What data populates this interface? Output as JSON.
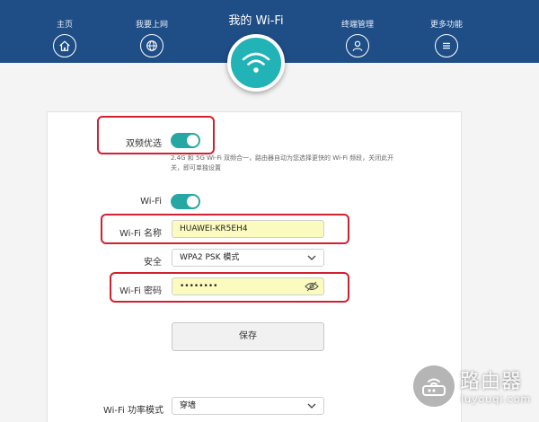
{
  "header": {
    "title": "我的 Wi-Fi",
    "nav": [
      {
        "label": "主页",
        "icon": "home-icon"
      },
      {
        "label": "我要上网",
        "icon": "globe-icon"
      },
      {
        "label": "终端管理",
        "icon": "user-icon"
      },
      {
        "label": "更多功能",
        "icon": "menu-icon"
      }
    ],
    "center_icon": "wifi-icon"
  },
  "form": {
    "dual_band": {
      "label": "双频优选",
      "on": true,
      "description": "2.4G 和 5G Wi-Fi 双频合一，路由器自动为您选择更快的 Wi-Fi 频段，关闭此开关，即可单独设置"
    },
    "wifi": {
      "label": "Wi-Fi",
      "on": true
    },
    "wifi_name": {
      "label": "Wi-Fi 名称",
      "value": "HUAWEI-KR5EH4"
    },
    "security": {
      "label": "安全",
      "value": "WPA2 PSK 模式"
    },
    "wifi_password": {
      "label": "Wi-Fi 密码",
      "value": "••••••••"
    },
    "save_label": "保存",
    "power_mode": {
      "label": "Wi-Fi 功率模式",
      "value": "穿墙"
    }
  },
  "watermark": {
    "name": "路由器",
    "site": "luyouqi.com"
  },
  "colors": {
    "header_bg": "#1f4e86",
    "accent": "#27a7a4",
    "highlight": "#d2202f",
    "field_fill": "#fbfbbf"
  }
}
